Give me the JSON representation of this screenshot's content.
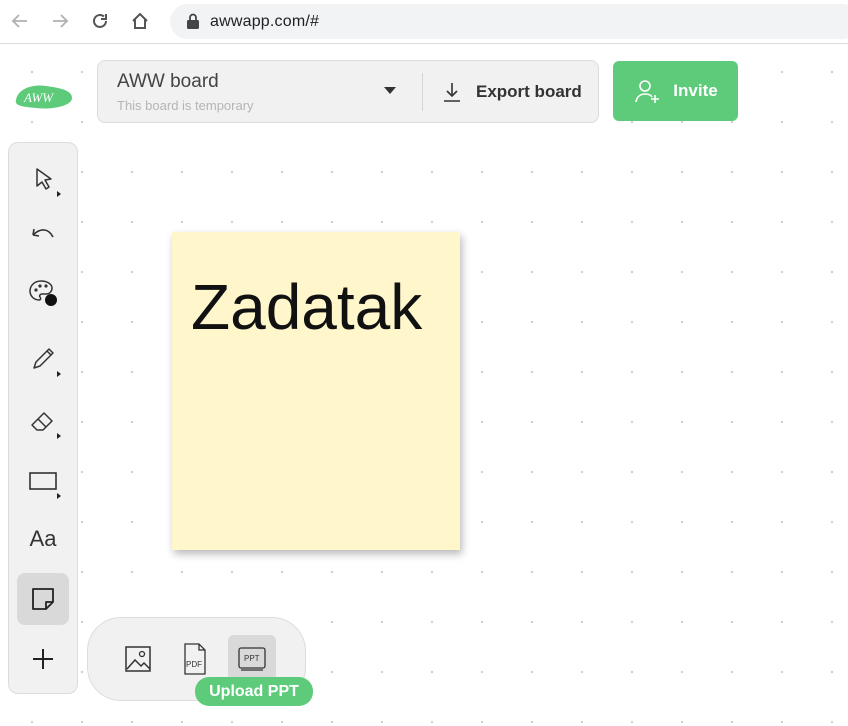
{
  "browser": {
    "url": "awwapp.com/#",
    "back_icon": "arrow-left-icon",
    "forward_icon": "arrow-right-icon",
    "reload_icon": "reload-icon",
    "home_icon": "home-icon",
    "lock_icon": "lock-icon"
  },
  "app": {
    "logo_text": "AWW",
    "brand_color": "#5ecb7a"
  },
  "board": {
    "title": "AWW board",
    "subtitle": "This board is temporary",
    "export_label": "Export board",
    "invite_label": "Invite"
  },
  "toolbar": {
    "tools": [
      {
        "name": "select",
        "icon": "cursor-arrow-icon"
      },
      {
        "name": "undo",
        "icon": "undo-icon"
      },
      {
        "name": "color",
        "icon": "palette-icon"
      },
      {
        "name": "pencil",
        "icon": "pencil-icon"
      },
      {
        "name": "eraser",
        "icon": "eraser-icon"
      },
      {
        "name": "shape",
        "icon": "rectangle-icon"
      },
      {
        "name": "text",
        "label": "Aa"
      },
      {
        "name": "sticky-note",
        "icon": "sticky-note-icon",
        "active": true
      },
      {
        "name": "add",
        "icon": "plus-icon"
      }
    ]
  },
  "sticky_note": {
    "text": "Zadatak",
    "color": "#fff6cc"
  },
  "upload_panel": {
    "items": [
      {
        "name": "image",
        "icon": "image-icon"
      },
      {
        "name": "pdf",
        "icon": "pdf-icon",
        "label": "PDF"
      },
      {
        "name": "ppt",
        "icon": "ppt-icon",
        "label": "PPT",
        "active": true
      }
    ],
    "tooltip": "Upload PPT"
  }
}
